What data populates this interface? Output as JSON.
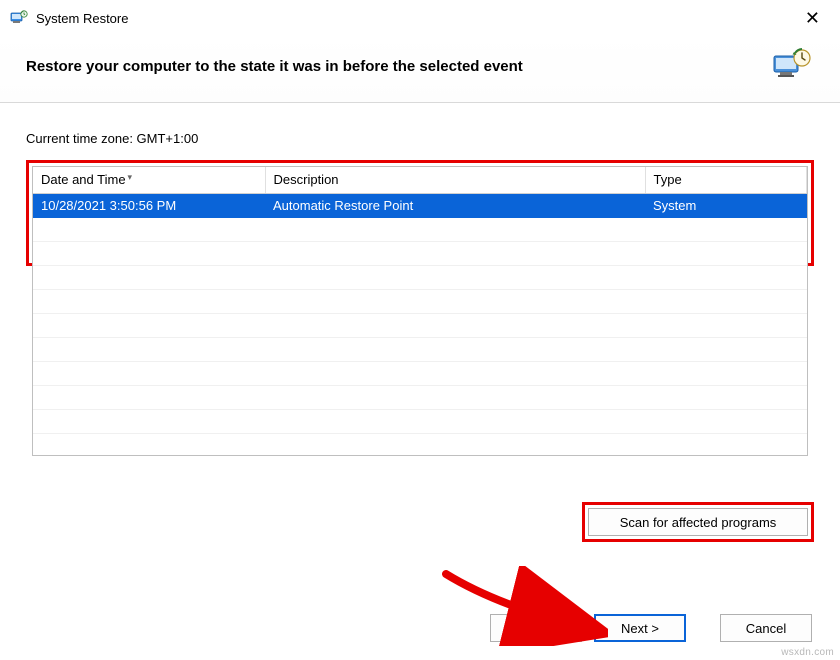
{
  "window": {
    "title": "System Restore"
  },
  "header": {
    "instruction": "Restore your computer to the state it was in before the selected event"
  },
  "timezone_label": "Current time zone: GMT+1:00",
  "table": {
    "columns": {
      "date": "Date and Time",
      "desc": "Description",
      "type": "Type"
    },
    "rows": [
      {
        "date": "10/28/2021 3:50:56 PM",
        "desc": "Automatic Restore Point",
        "type": "System",
        "selected": true
      }
    ]
  },
  "buttons": {
    "scan": "Scan for affected programs",
    "back": "< Back",
    "next": "Next >",
    "cancel": "Cancel"
  },
  "watermark": "wsxdn.com"
}
